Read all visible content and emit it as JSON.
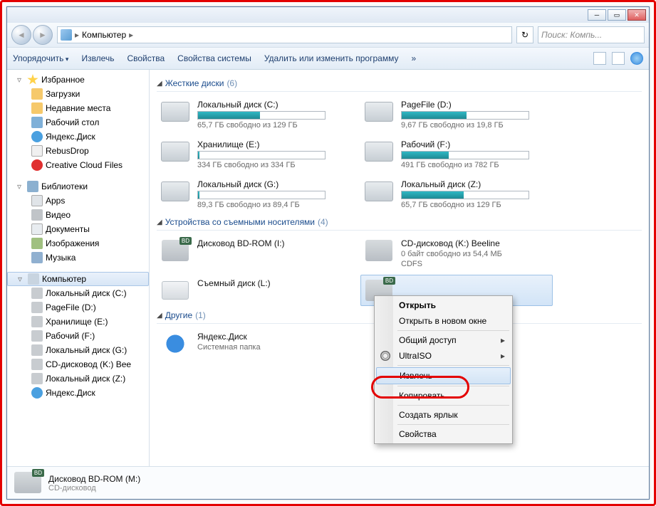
{
  "breadcrumb": {
    "location": "Компьютер"
  },
  "search": {
    "placeholder": "Поиск: Компь..."
  },
  "cmdbar": {
    "organize": "Упорядочить",
    "eject": "Извлечь",
    "properties": "Свойства",
    "sysprops": "Свойства системы",
    "uninstall": "Удалить или изменить программу"
  },
  "tree": {
    "favorites": "Избранное",
    "downloads": "Загрузки",
    "recent": "Недавние места",
    "desktop": "Рабочий стол",
    "yadisk": "Яндекс.Диск",
    "rebus": "RebusDrop",
    "cc": "Creative Cloud Files",
    "libs": "Библиотеки",
    "apps": "Apps",
    "video": "Видео",
    "docs": "Документы",
    "images": "Изображения",
    "music": "Музыка",
    "computer": "Компьютер",
    "driveC": "Локальный диск (C:)",
    "driveD": "PageFile (D:)",
    "driveE": "Хранилище (E:)",
    "driveF": "Рабочий (F:)",
    "driveG": "Локальный диск (G:)",
    "driveK": "CD-дисковод (K:) Bee",
    "driveZ": "Локальный диск (Z:)",
    "yadisk2": "Яндекс.Диск"
  },
  "groups": {
    "hdd_label": "Жесткие диски",
    "hdd_count": "(6)",
    "removable_label": "Устройства со съемными носителями",
    "removable_count": "(4)",
    "other_label": "Другие",
    "other_count": "(1)"
  },
  "drives": {
    "c": {
      "name": "Локальный диск (C:)",
      "free": "65,7 ГБ свободно из 129 ГБ",
      "fill": 49
    },
    "d": {
      "name": "PageFile (D:)",
      "free": "9,67 ГБ свободно из 19,8 ГБ",
      "fill": 51
    },
    "e": {
      "name": "Хранилище (E:)",
      "free": "334 ГБ свободно из 334 ГБ",
      "fill": 1
    },
    "f": {
      "name": "Рабочий (F:)",
      "free": "491 ГБ свободно из 782 ГБ",
      "fill": 37
    },
    "g": {
      "name": "Локальный диск (G:)",
      "free": "89,3 ГБ свободно из 89,4 ГБ",
      "fill": 1
    },
    "z": {
      "name": "Локальный диск (Z:)",
      "free": "65,7 ГБ свободно из 129 ГБ",
      "fill": 49
    },
    "i": {
      "name": "Дисковод BD-ROM (I:)"
    },
    "k": {
      "name": "CD-дисковод (K:) Beeline",
      "free": "0 байт свободно из 54,4 МБ",
      "fs": "CDFS"
    },
    "l": {
      "name": "Съемный диск (L:)"
    },
    "m": {
      "name": ""
    },
    "ya": {
      "name": "Яндекс.Диск",
      "sub": "Системная папка"
    }
  },
  "ctxmenu": {
    "open": "Открыть",
    "open_new": "Открыть в новом окне",
    "share": "Общий доступ",
    "ultraiso": "UltraISO",
    "eject": "Извлечь",
    "copy": "Копировать",
    "shortcut": "Создать ярлык",
    "properties": "Свойства"
  },
  "status": {
    "title": "Дисковод BD-ROM (M:)",
    "sub": "CD-дисковод"
  }
}
